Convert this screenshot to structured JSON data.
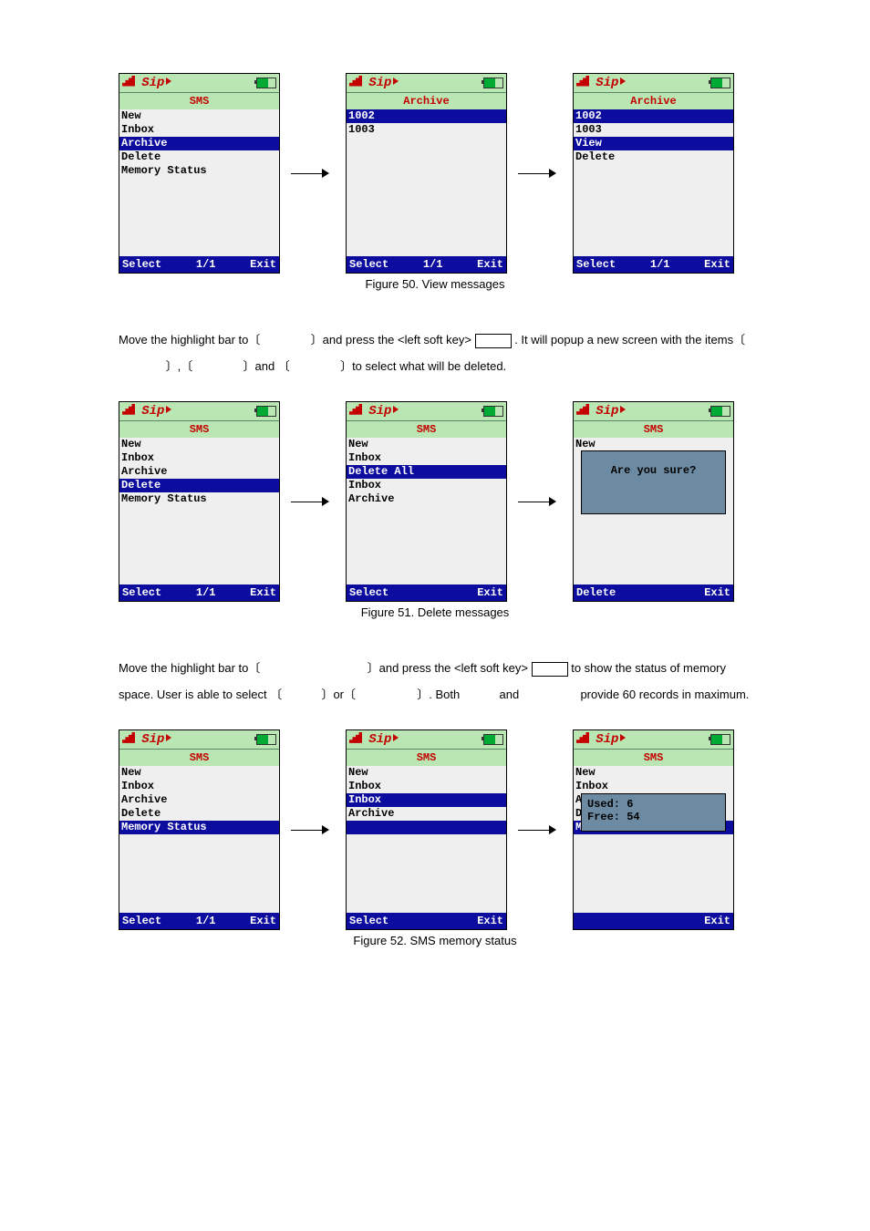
{
  "figures": {
    "f50": {
      "caption": "Figure 50. View messages"
    },
    "f51": {
      "caption": "Figure 51. Delete messages"
    },
    "f52": {
      "caption": "Figure 52. SMS memory status"
    }
  },
  "screens": {
    "blank": [
      "",
      "",
      "",
      "",
      "",
      "",
      "",
      "",
      "",
      ""
    ],
    "sms_full": {
      "title": "SMS",
      "items": [
        "New",
        "Inbox",
        "Archive",
        "Delete",
        "Memory Status"
      ]
    },
    "archive_list": {
      "title": "Archive",
      "items": [
        "1002",
        "1003"
      ]
    },
    "archive_opts": {
      "title": "Archive",
      "items": [
        "1002",
        "1003",
        "View",
        "Delete"
      ]
    },
    "delete_scope": {
      "title": "SMS",
      "items": [
        "New",
        "Inbox",
        "Delete All",
        "Inbox",
        "Archive"
      ]
    },
    "confirm": {
      "title": "SMS",
      "items": [
        "New"
      ],
      "popup": "Are you sure?"
    },
    "mem_scope": {
      "title": "SMS",
      "items": [
        "New",
        "Inbox",
        "Inbox",
        "Archive",
        ""
      ]
    },
    "mem_result": {
      "title": "SMS",
      "items": [
        "New",
        "Inbox",
        "Ar",
        "De",
        "Me"
      ],
      "popup": {
        "l1": "Used: 6",
        "l2": "Free: 54"
      }
    }
  },
  "softkeys": {
    "select": "Select",
    "exit": "Exit",
    "delete": "Delete",
    "page": "1/1"
  },
  "para": {
    "p1a": "Move the highlight bar to〔",
    "p1b": "〕and press the <left soft key>",
    "p1c": ". It will popup a new screen with the items〔",
    "p1d": "〕,〔",
    "p1e": "〕and 〔",
    "p1f": "〕to select what will be deleted.",
    "p2a": "Move the highlight bar to〔",
    "p2b": "〕and press the <left soft key>",
    "p2c": "to show the status of memory space. User is able to select 〔",
    "p2d": "〕or〔",
    "p2e": "〕. Both",
    "p2f": "and",
    "p2g": "provide 60 records in maximum."
  }
}
